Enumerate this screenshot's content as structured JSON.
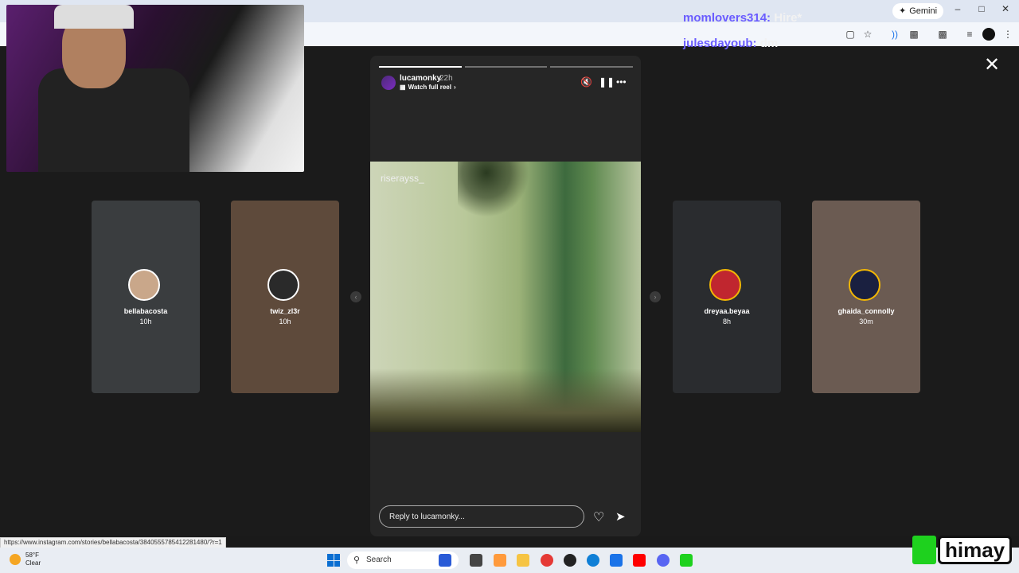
{
  "browser": {
    "gemini_label": "Gemini",
    "window_controls": [
      "–",
      "□",
      "✕"
    ]
  },
  "chat_overlay": [
    {
      "user": "momlovers314:",
      "message": "Hire*"
    },
    {
      "user": "julesdayoub:",
      "message": "dm"
    }
  ],
  "story": {
    "username": "lucamonky",
    "time_ago": "22h",
    "watch_full_reel": "Watch full reel",
    "media_label": "riserayss_",
    "reply_placeholder": "Reply to lucamonky...",
    "progress_segments": 3,
    "progress_done": 1
  },
  "side_stories": [
    {
      "name": "bellabacosta",
      "time": "10h",
      "bg": "#3a3d3f",
      "avatar_color": "#c9a78a"
    },
    {
      "name": "twiz_zl3r",
      "time": "10h",
      "bg": "#5e4a3b",
      "avatar_color": "#2a2a2a"
    },
    {
      "name": "dreyaa.beyaa",
      "time": "8h",
      "bg": "#2a2c2f",
      "avatar_color": "#c0262f"
    },
    {
      "name": "ghaida_connolly",
      "time": "30m",
      "bg": "#6b5b52",
      "avatar_color": "#1a2040"
    }
  ],
  "status_url": "https://www.instagram.com/stories/bellabacosta/3840555785412281480/?r=1",
  "taskbar": {
    "temperature": "58°F",
    "condition": "Clear",
    "search_label": "Search",
    "apps": [
      "#2a5bd7",
      "#444",
      "#ff9a3c",
      "#f6c443",
      "#e53935",
      "#222",
      "#0f7fd6",
      "#1a73e8",
      "#ff0000",
      "#5865f2",
      "#1ed11e"
    ]
  },
  "watermark": "himay"
}
